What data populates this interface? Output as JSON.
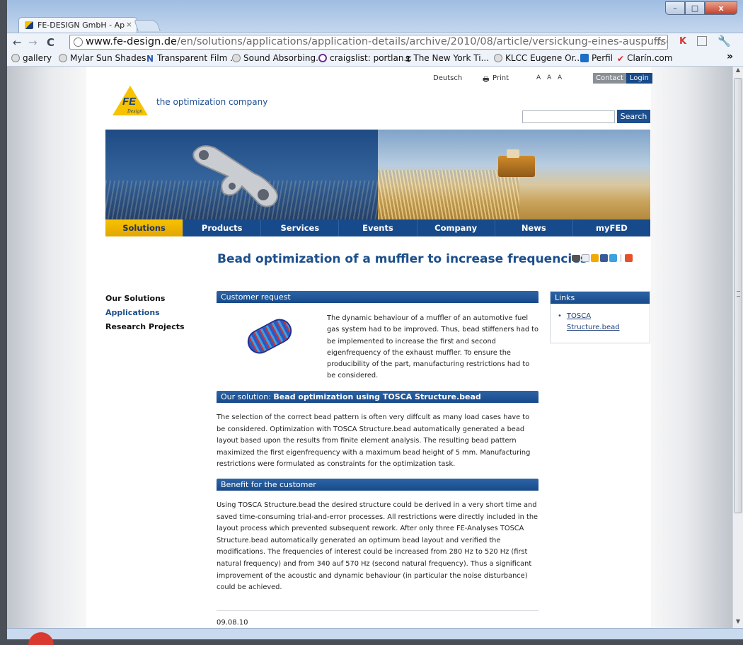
{
  "browser": {
    "tab_title": "FE-DESIGN GmbH - Ap",
    "tab_close": "×",
    "url_host": "www.fe-design.de",
    "url_path": "/en/solutions/applications/application-details/archive/2010/08/article/versickung-eines-auspuffschalldaempfers-zu",
    "window_buttons": {
      "minimize": "–",
      "maximize": "□",
      "close": "x"
    },
    "nav": {
      "back": "←",
      "forward": "→",
      "reload": "C"
    },
    "star": "☆",
    "overflow": "»",
    "bookmarks": [
      {
        "label": "gallery",
        "icon": "globe-icon"
      },
      {
        "label": "Mylar Sun Shades",
        "icon": "globe-icon"
      },
      {
        "label": "Transparent Film ...",
        "icon": "n-icon"
      },
      {
        "label": "Sound Absorbing...",
        "icon": "globe-icon"
      },
      {
        "label": "craigslist: portlan...",
        "icon": "peace-icon"
      },
      {
        "label": "The New York Ti...",
        "icon": "nyt-icon"
      },
      {
        "label": "KLCC Eugene Or...",
        "icon": "globe-icon"
      },
      {
        "label": "Perfil",
        "icon": "perfil-icon"
      },
      {
        "label": "Clarín.com",
        "icon": "clarin-icon"
      }
    ]
  },
  "header": {
    "language": "Deutsch",
    "print": "Print",
    "font_sizes": "A A A",
    "contact": "Contact",
    "login": "Login",
    "logo_text": "FE",
    "logo_sub": "Design",
    "tagline": "the optimization company",
    "search_button": "Search",
    "search_value": ""
  },
  "nav": {
    "items": [
      "Solutions",
      "Products",
      "Services",
      "Events",
      "Company",
      "News",
      "myFED"
    ]
  },
  "sidebar": {
    "items": [
      "Our Solutions",
      "Applications",
      "Research Projects"
    ]
  },
  "article": {
    "title": "Bead optimization of a muffler to increase frequencies",
    "sections": {
      "customer_request": "Customer request",
      "our_solution_prefix": "Our solution: ",
      "our_solution_bold": "Bead optimization using TOSCA Structure.bead",
      "benefit": "Benefit for the customer"
    },
    "intro": "The dynamic behaviour of a muffler of an automotive fuel gas system had to be improved. Thus, bead stiffeners had to be implemented to increase the first and second eigenfrequency of the exhaust muffler. To ensure the producibility of the part, manufacturing restrictions had to be considered.",
    "solution_text": "The selection of the correct bead pattern is often very diffcult as many load cases have to be considered. Optimization with TOSCA Structure.bead automatically generated a bead layout based upon the results from finite element analysis. The resulting bead pattern maximized the first eigenfrequency with a maximum bead height of 5 mm. Manufacturing restrictions were formulated as constraints for the optimization task.",
    "benefit_text": "Using TOSCA Structure.bead the desired structure could be derived in a very short time and saved time-consuming trial-and-error processes. All restrictions were directly included in the layout process which prevented subsequent rework. After only three FE-Analyses TOSCA Structure.bead automatically generated an optimum bead layout and verified the modifications. The frequencies of interest could be increased from 280 Hz to 520 Hz (first natural frequency) and from 340 auf 570 Hz (second natural frequency). Thus a significant improvement of the acoustic and dynamic behaviour (in particular the noise disturbance) could be achieved.",
    "date": "09.08.10"
  },
  "links": {
    "heading": "Links",
    "items": [
      "TOSCA Structure.bead"
    ]
  },
  "colors": {
    "brand_blue": "#174a8a",
    "brand_yellow": "#f7c300"
  }
}
